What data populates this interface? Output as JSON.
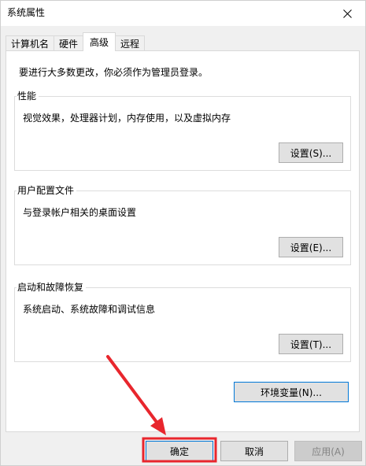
{
  "window": {
    "title": "系统属性"
  },
  "tabs": [
    {
      "label": "计算机名",
      "active": false
    },
    {
      "label": "硬件",
      "active": false
    },
    {
      "label": "高级",
      "active": true
    },
    {
      "label": "远程",
      "active": false
    }
  ],
  "advanced": {
    "admin_note": "要进行大多数更改，你必须作为管理员登录。",
    "performance": {
      "title": "性能",
      "description": "视觉效果，处理器计划，内存使用，以及虚拟内存",
      "button": "设置(S)..."
    },
    "user_profiles": {
      "title": "用户配置文件",
      "description": "与登录帐户相关的桌面设置",
      "button": "设置(E)..."
    },
    "startup_recovery": {
      "title": "启动和故障恢复",
      "description": "系统启动、系统故障和调试信息",
      "button": "设置(T)..."
    },
    "env_vars_button": "环境变量(N)..."
  },
  "footer": {
    "ok": "确定",
    "cancel": "取消",
    "apply": "应用(A)"
  },
  "colors": {
    "annotation": "#e8262d",
    "focus": "#0078d7",
    "disabled_text": "#838383"
  }
}
